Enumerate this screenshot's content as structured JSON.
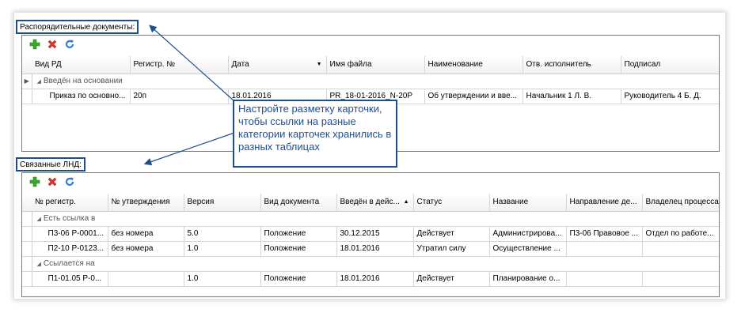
{
  "colors": {
    "accent": "#1f4e8c",
    "add": "#3aa82a",
    "delete": "#d9342b",
    "refresh": "#2f7fd0"
  },
  "top": {
    "label": "Распорядительные документы:",
    "toolbar": [
      {
        "icon": "add-icon"
      },
      {
        "icon": "delete-icon"
      },
      {
        "icon": "refresh-icon"
      }
    ],
    "columns": [
      "Вид РД",
      "Регистр. №",
      "Дата",
      "Имя файла",
      "Наименование",
      "Отв. исполнитель",
      "Подписал"
    ],
    "sort_indicator": "▼",
    "group": "Введён на основании",
    "rows": [
      [
        "Приказ по основно...",
        "20п",
        "18.01.2016",
        "PR_18-01-2016_N-20P",
        "Об утверждении и вве...",
        "Начальник 1 Л. В.",
        "Руководитель 4 Б. Д."
      ]
    ]
  },
  "bottom": {
    "label": "Связанные ЛНД:",
    "toolbar": [
      {
        "icon": "add-icon"
      },
      {
        "icon": "delete-icon"
      },
      {
        "icon": "refresh-icon"
      }
    ],
    "columns": [
      "№ регистр.",
      "№ утверждения",
      "Версия",
      "Вид документа",
      "Введён в дейс...",
      "Статус",
      "Название",
      "Направление де...",
      "Владелец процесса"
    ],
    "sort_indicator": "▲",
    "groups": [
      {
        "label": "Есть ссылка в",
        "rows": [
          [
            "П3-06 Р-0001...",
            "без номера",
            "5.0",
            "Положение",
            "30.12.2015",
            "Действует",
            "Администрирова...",
            "П3-06 Правовое ...",
            "Отдел по работе..."
          ],
          [
            "П2-10 Р-0123...",
            "без номера",
            "1.0",
            "Положение",
            "18.01.2016",
            "Утратил силу",
            "Осуществление ...",
            "",
            ""
          ]
        ]
      },
      {
        "label": "Ссылается на",
        "rows": [
          [
            "П1-01.05 Р-0...",
            "",
            "1.0",
            "Положение",
            "18.01.2016",
            "Действует",
            "Планирование о...",
            "",
            ""
          ]
        ]
      }
    ]
  },
  "callout": {
    "text": "Настройте разметку карточки, чтобы ссылки на разные категории карточек хранились в разных таблицах"
  }
}
